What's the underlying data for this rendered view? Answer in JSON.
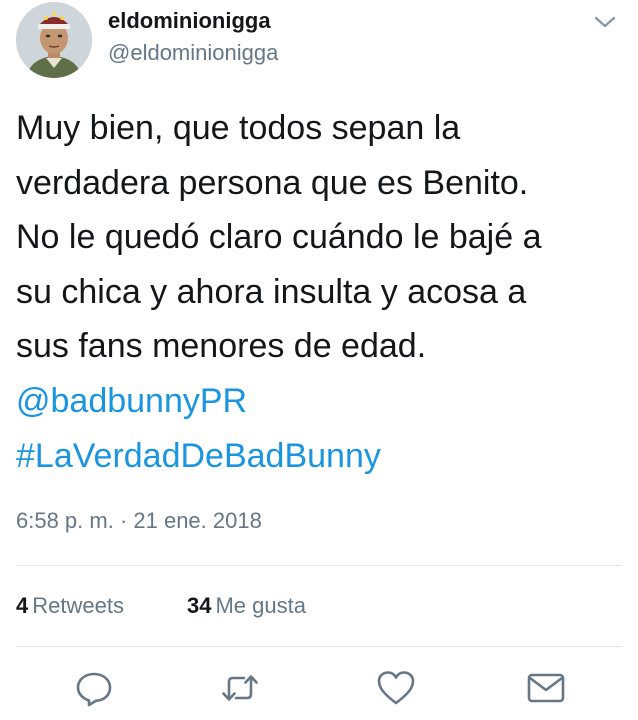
{
  "user": {
    "display_name": "eldominionigga",
    "handle": "@eldominionigga",
    "avatar_icon": "user-avatar"
  },
  "menu": {
    "icon": "chevron-down-icon"
  },
  "tweet": {
    "lines": [
      "Muy bien, que todos sepan la",
      "verdadera persona que es Benito.",
      "No le quedó claro cuándo le bajé a",
      "su chica y ahora insulta y acosa a",
      "sus fans menores de edad."
    ],
    "mention": "@badbunnyPR",
    "hashtag": "#LaVerdadDeBadBunny",
    "timestamp": "6:58 p. m. · 21 ene. 2018"
  },
  "stats": {
    "retweets_count": "4",
    "retweets_label": "Retweets",
    "likes_count": "34",
    "likes_label": "Me gusta"
  },
  "actions": {
    "reply_icon": "reply-icon",
    "retweet_icon": "retweet-icon",
    "like_icon": "heart-icon",
    "dm_icon": "envelope-icon"
  },
  "colors": {
    "link": "#1b95e0",
    "secondary_text": "#657786",
    "primary_text": "#14171a",
    "divider": "#e1e8ed"
  }
}
